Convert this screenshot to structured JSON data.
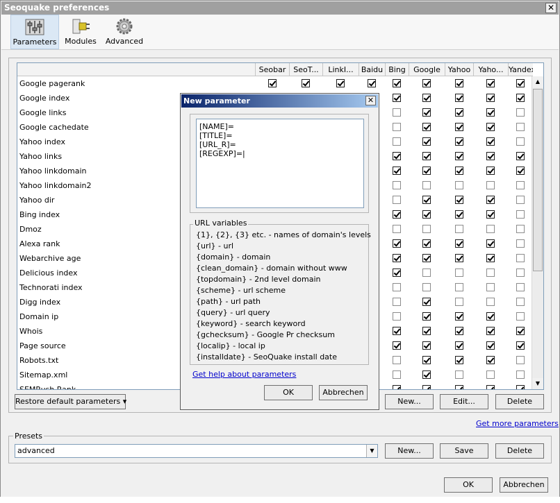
{
  "window": {
    "title": "Seoquake preferences",
    "close_label": "✕"
  },
  "toolbar": {
    "tabs": [
      {
        "label": "Parameters",
        "icon": "sliders-icon"
      },
      {
        "label": "Modules",
        "icon": "plugin-icon"
      },
      {
        "label": "Advanced",
        "icon": "gear-icon"
      }
    ]
  },
  "table": {
    "columns": [
      "Seobar",
      "SeoT...",
      "LinkI...",
      "Baidu",
      "Bing",
      "Google",
      "Yahoo",
      "Yaho...",
      "Yandex"
    ],
    "rows": [
      {
        "name": "Google pagerank",
        "checks": [
          1,
          1,
          1,
          1,
          1,
          1,
          1,
          1,
          1
        ]
      },
      {
        "name": "Google index",
        "checks": [
          1,
          1,
          1,
          0,
          1,
          1,
          1,
          1,
          1
        ]
      },
      {
        "name": "Google links",
        "checks": [
          0,
          0,
          0,
          0,
          0,
          1,
          1,
          1,
          0
        ]
      },
      {
        "name": "Google cachedate",
        "checks": [
          0,
          0,
          0,
          0,
          0,
          1,
          1,
          1,
          0
        ]
      },
      {
        "name": "Yahoo index",
        "checks": [
          0,
          0,
          0,
          0,
          0,
          1,
          1,
          1,
          0
        ]
      },
      {
        "name": "Yahoo links",
        "checks": [
          0,
          0,
          0,
          0,
          1,
          1,
          1,
          1,
          1
        ]
      },
      {
        "name": "Yahoo linkdomain",
        "checks": [
          0,
          0,
          0,
          0,
          1,
          1,
          1,
          1,
          1
        ]
      },
      {
        "name": "Yahoo linkdomain2",
        "checks": [
          0,
          0,
          0,
          0,
          0,
          0,
          0,
          0,
          0
        ]
      },
      {
        "name": "Yahoo dir",
        "checks": [
          0,
          0,
          0,
          0,
          0,
          1,
          1,
          1,
          0
        ]
      },
      {
        "name": "Bing index",
        "checks": [
          0,
          0,
          0,
          0,
          1,
          1,
          1,
          1,
          0
        ]
      },
      {
        "name": "Dmoz",
        "checks": [
          0,
          0,
          0,
          0,
          0,
          0,
          0,
          0,
          0
        ]
      },
      {
        "name": "Alexa rank",
        "checks": [
          0,
          0,
          0,
          0,
          1,
          1,
          1,
          1,
          0
        ]
      },
      {
        "name": "Webarchive age",
        "checks": [
          0,
          0,
          0,
          0,
          1,
          1,
          1,
          1,
          0
        ]
      },
      {
        "name": "Delicious index",
        "checks": [
          0,
          0,
          0,
          0,
          1,
          0,
          0,
          0,
          0
        ]
      },
      {
        "name": "Technorati index",
        "checks": [
          0,
          0,
          0,
          0,
          0,
          0,
          0,
          0,
          0
        ]
      },
      {
        "name": "Digg index",
        "checks": [
          0,
          0,
          0,
          0,
          0,
          1,
          0,
          0,
          0
        ]
      },
      {
        "name": "Domain ip",
        "checks": [
          0,
          0,
          0,
          0,
          0,
          1,
          1,
          1,
          0
        ]
      },
      {
        "name": "Whois",
        "checks": [
          0,
          0,
          0,
          0,
          1,
          1,
          1,
          1,
          1
        ]
      },
      {
        "name": "Page source",
        "checks": [
          0,
          0,
          0,
          0,
          1,
          1,
          1,
          1,
          1
        ]
      },
      {
        "name": "Robots.txt",
        "checks": [
          0,
          0,
          0,
          0,
          0,
          1,
          1,
          1,
          0
        ]
      },
      {
        "name": "Sitemap.xml",
        "checks": [
          0,
          0,
          0,
          0,
          0,
          1,
          0,
          0,
          0
        ]
      },
      {
        "name": "SEMRush Rank",
        "checks": [
          0,
          0,
          0,
          0,
          1,
          1,
          1,
          1,
          1
        ]
      }
    ]
  },
  "params_buttons": {
    "restore": "Restore default parameters",
    "restore_arrow": "▾",
    "new": "New...",
    "edit": "Edit...",
    "delete": "Delete"
  },
  "more_link": "Get more parameters",
  "presets": {
    "legend": "Presets",
    "selected": "advanced",
    "dd_arrow": "▼",
    "new": "New...",
    "save": "Save",
    "delete": "Delete"
  },
  "footer": {
    "ok": "OK",
    "cancel": "Abbrechen"
  },
  "dialog": {
    "title": "New parameter",
    "close_label": "✕",
    "text_value": "[NAME]=\n[TITLE]=\n[URL_R]=\n[REGEXP]=|",
    "url_vars_legend": "URL variables",
    "url_vars": [
      "{1}, {2}, {3} etc. - names of domain's levels",
      "{url} - url",
      "{domain} - domain",
      "{clean_domain} - domain without www",
      "{topdomain} - 2nd level domain",
      "{scheme} - url scheme",
      "{path} - url path",
      "{query} - url query",
      "{keyword} - search keyword",
      "{gchecksum} - Google Pr checksum",
      "{localip} - local ip",
      "{installdate} - SeoQuake install date"
    ],
    "help_link": "Get help about parameters",
    "ok": "OK",
    "cancel": "Abbrechen"
  },
  "scroll": {
    "up": "▲",
    "down": "▼"
  }
}
